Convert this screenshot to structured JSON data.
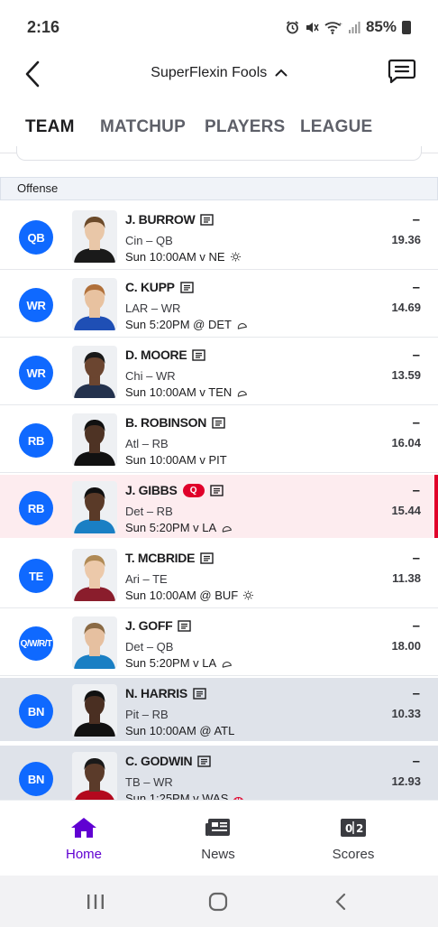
{
  "status": {
    "time": "2:16",
    "battery": "85%"
  },
  "header": {
    "league_name": "SuperFlexin Fools"
  },
  "tabs": [
    {
      "label": "TEAM",
      "active": true
    },
    {
      "label": "MATCHUP",
      "active": false
    },
    {
      "label": "PLAYERS",
      "active": false
    },
    {
      "label": "LEAGUE",
      "active": false
    }
  ],
  "section": {
    "title": "Offense"
  },
  "players": [
    {
      "slot": "QB",
      "name": "J. BURROW",
      "team_pos": "Cin – QB",
      "game": "Sun 10:00AM v NE",
      "weather": "sun-icon",
      "proj": "–",
      "points": "19.36",
      "status": "",
      "state": "normal"
    },
    {
      "slot": "WR",
      "name": "C. KUPP",
      "team_pos": "LAR – WR",
      "game": "Sun 5:20PM @ DET",
      "weather": "dome-icon",
      "proj": "–",
      "points": "14.69",
      "status": "",
      "state": "normal"
    },
    {
      "slot": "WR",
      "name": "D. MOORE",
      "team_pos": "Chi – WR",
      "game": "Sun 10:00AM v TEN",
      "weather": "cloud-icon",
      "proj": "–",
      "points": "13.59",
      "status": "",
      "state": "normal"
    },
    {
      "slot": "RB",
      "name": "B. ROBINSON",
      "team_pos": "Atl – RB",
      "game": "Sun 10:00AM v PIT",
      "weather": "",
      "proj": "–",
      "points": "16.04",
      "status": "",
      "state": "normal"
    },
    {
      "slot": "RB",
      "name": "J. GIBBS",
      "team_pos": "Det – RB",
      "game": "Sun 5:20PM v LA",
      "weather": "dome-icon",
      "proj": "–",
      "points": "15.44",
      "status": "Q",
      "state": "injured"
    },
    {
      "slot": "TE",
      "name": "T. MCBRIDE",
      "team_pos": "Ari – TE",
      "game": "Sun 10:00AM @ BUF",
      "weather": "sun-icon",
      "proj": "–",
      "points": "11.38",
      "status": "",
      "state": "normal"
    },
    {
      "slot": "Q/W/R/T",
      "name": "J. GOFF",
      "team_pos": "Det – QB",
      "game": "Sun 5:20PM v LA",
      "weather": "dome-icon",
      "proj": "–",
      "points": "18.00",
      "status": "",
      "state": "normal"
    },
    {
      "slot": "BN",
      "name": "N. HARRIS",
      "team_pos": "Pit – RB",
      "game": "Sun 10:00AM @ ATL",
      "weather": "",
      "proj": "–",
      "points": "10.33",
      "status": "",
      "state": "bench"
    },
    {
      "slot": "BN",
      "name": "C. GODWIN",
      "team_pos": "TB – WR",
      "game": "Sun 1:25PM v WAS",
      "weather": "wind-icon",
      "proj": "–",
      "points": "12.93",
      "status": "",
      "state": "bench"
    }
  ],
  "bottom_nav": [
    {
      "label": "Home",
      "icon": "home-icon",
      "active": true
    },
    {
      "label": "News",
      "icon": "news-icon",
      "active": false
    },
    {
      "label": "Scores",
      "icon": "scores-icon",
      "active": false
    }
  ],
  "colors": {
    "accent": "#6001d2",
    "badge": "#0f69ff",
    "injury": "#e0002a"
  }
}
